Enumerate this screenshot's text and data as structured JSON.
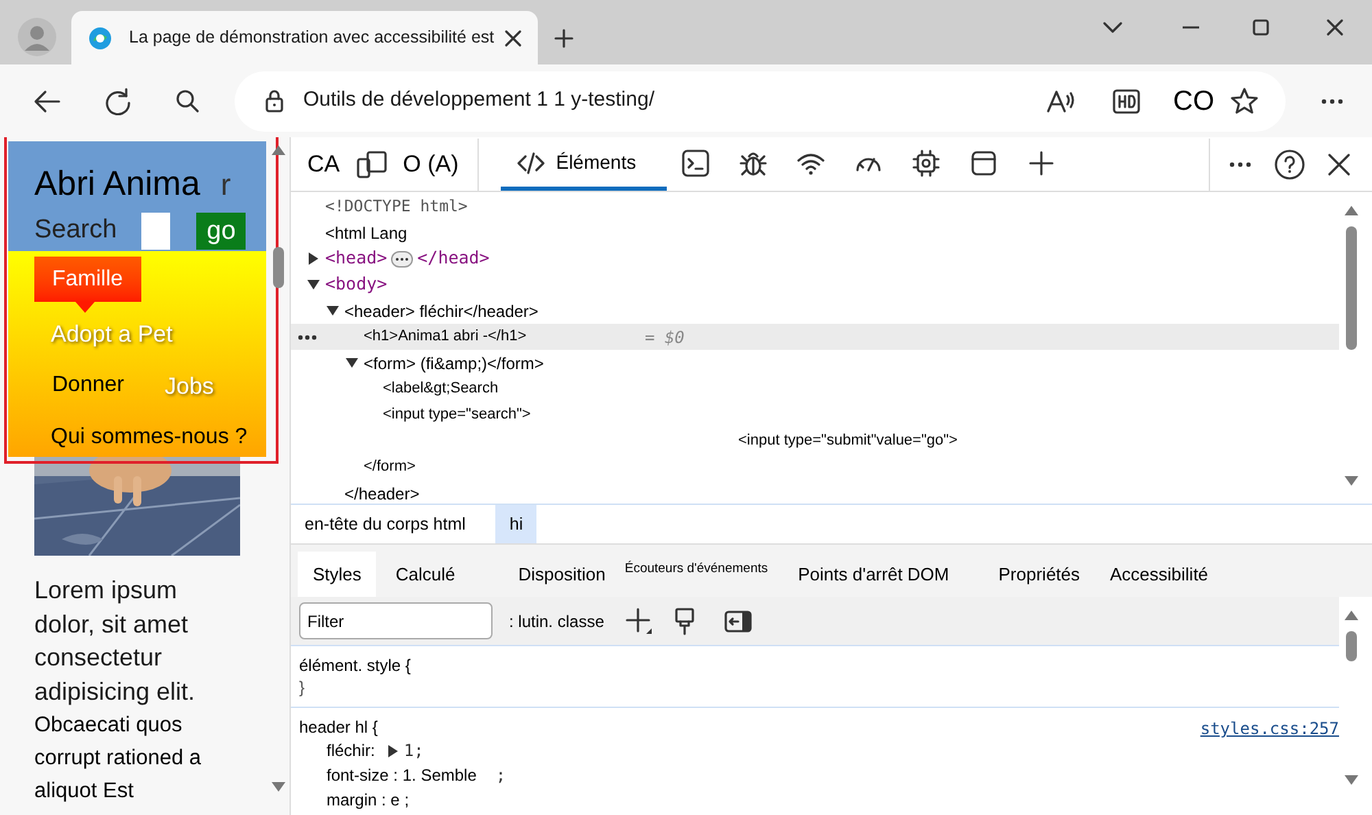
{
  "browser": {
    "tab": {
      "title": "La page de démonstration avec accessibilité est"
    },
    "address": "Outils de développement 1 1 y-testing/",
    "profile_text": "CO"
  },
  "page": {
    "title": "Abri Anima",
    "title_tail": "r",
    "search_label": "Search",
    "search_button": "go",
    "nav": [
      {
        "label": "Famille",
        "selected": true,
        "kind": "light"
      },
      {
        "label": "Adopt a Pet",
        "selected": false,
        "kind": "light"
      },
      {
        "label": "Donner",
        "selected": false,
        "kind": "dark"
      },
      {
        "label": "Jobs",
        "selected": false,
        "kind": "light"
      },
      {
        "label": "Qui sommes-nous ?",
        "selected": false,
        "kind": "dark"
      }
    ],
    "paragraph_large": "Lorem ipsum dolor, sit amet consectetur adipisicing elit.",
    "paragraph_small": "Obcaecati quos corrupt rationed a aliquot Est"
  },
  "devtools": {
    "left_tools": [
      {
        "kind": "text",
        "label": "CA"
      },
      {
        "kind": "device"
      },
      {
        "kind": "text",
        "label": "O (A)"
      }
    ],
    "tabs": [
      {
        "kind": "elements",
        "label": "Éléments",
        "selected": true
      },
      {
        "kind": "console",
        "selected": false
      },
      {
        "kind": "bug",
        "selected": false
      },
      {
        "kind": "network",
        "selected": false
      },
      {
        "kind": "performance",
        "selected": false
      },
      {
        "kind": "memory",
        "selected": false
      },
      {
        "kind": "application",
        "selected": false
      },
      {
        "kind": "add",
        "selected": false
      }
    ],
    "dom": [
      {
        "kind": "doctype",
        "text": "<!DOCTYPE html>"
      },
      {
        "kind": "plain",
        "text": "<html Lang"
      },
      {
        "kind": "tag",
        "open": "<head>",
        "close": "</head>",
        "expanded": false
      },
      {
        "kind": "tag",
        "open": "<body>",
        "expanded": true,
        "children": [
          {
            "kind": "plain",
            "text": "<header> fléchir</header>",
            "expanded": true,
            "children": [
              {
                "kind": "plain",
                "text": "<h1>Anima1 abri -</h1>",
                "selected": true,
                "hint": "= $0"
              },
              {
                "kind": "plain",
                "text": "<form> (fi&amp;)</form>",
                "expanded": true,
                "children": [
                  {
                    "kind": "plain",
                    "text": "<label&gt;Search"
                  },
                  {
                    "kind": "plain",
                    "text": "<input type=\"search\">"
                  },
                  {
                    "kind": "offset",
                    "text": "<input type=\"submit\"value=\"go\">"
                  }
                ]
              },
              {
                "kind": "plain",
                "text": "</form>"
              }
            ]
          },
          {
            "kind": "plain",
            "text": "</header>"
          }
        ]
      }
    ],
    "breadcrumbs": [
      {
        "label": "en-tête du corps html",
        "selected": false
      },
      {
        "label": "hi",
        "selected": true
      }
    ],
    "panel_tabs": [
      {
        "label": "Styles",
        "selected": true
      },
      {
        "label": "Calculé",
        "selected": false
      },
      {
        "label": "Disposition",
        "selected": false
      },
      {
        "label": "Écouteurs d'événements",
        "selected": false,
        "kind": "small"
      },
      {
        "label": "Points d'arrêt DOM",
        "selected": false
      },
      {
        "label": "Propriétés",
        "selected": false
      },
      {
        "label": "Accessibilité",
        "selected": false
      }
    ],
    "filter": {
      "placeholder": "Filter"
    },
    "pseudo_toggle": ": lutin. classe",
    "rules": [
      {
        "selector": "élément. style {",
        "close": "}"
      },
      {
        "selector": "header hl {",
        "source": "styles.css:257",
        "declarations": [
          {
            "name": "fléchir:",
            "value": "1;",
            "expandable": true
          },
          {
            "name": "font-size : 1. Semble",
            "value": ";"
          },
          {
            "name": "margin : e ;"
          }
        ]
      }
    ]
  }
}
